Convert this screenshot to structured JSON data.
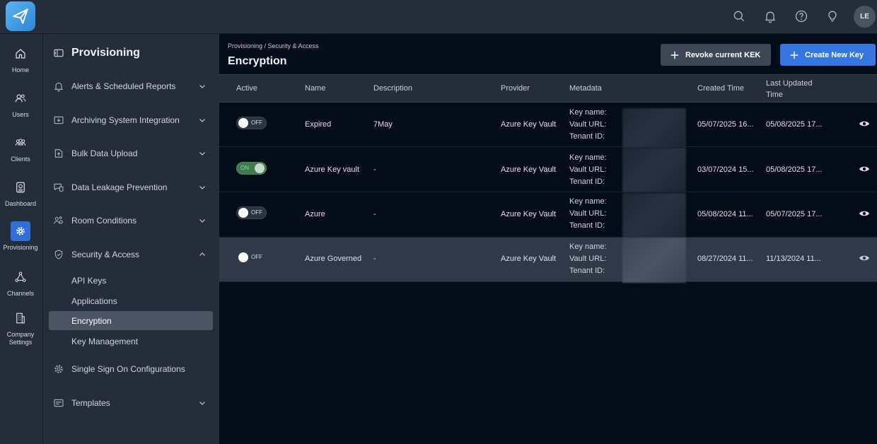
{
  "topbar": {
    "avatar_initials": "LE",
    "icons": [
      "search-icon",
      "bell-icon",
      "help-icon",
      "lightbulb-icon"
    ]
  },
  "rail": {
    "items": [
      {
        "label": "Home",
        "icon": "home-icon"
      },
      {
        "label": "Users",
        "icon": "users-icon"
      },
      {
        "label": "Clients",
        "icon": "clients-icon"
      },
      {
        "label": "Dashboard",
        "icon": "dashboard-icon"
      },
      {
        "label": "Provisioning",
        "icon": "gear-icon",
        "active": true
      },
      {
        "label": "Channels",
        "icon": "channels-icon"
      },
      {
        "label": "Company Settings",
        "icon": "building-icon"
      }
    ]
  },
  "panel": {
    "title": "Provisioning",
    "menu": [
      {
        "label": "Alerts & Scheduled Reports"
      },
      {
        "label": "Archiving System Integration"
      },
      {
        "label": "Bulk Data Upload"
      },
      {
        "label": "Data Leakage Prevention"
      },
      {
        "label": "Room Conditions"
      },
      {
        "label": "Security & Access",
        "expanded": true
      },
      {
        "label": "Single Sign On Configurations"
      },
      {
        "label": "Templates"
      }
    ],
    "submenu": [
      {
        "label": "API Keys"
      },
      {
        "label": "Applications"
      },
      {
        "label": "Encryption",
        "active": true
      },
      {
        "label": "Key Management"
      }
    ]
  },
  "main": {
    "breadcrumb": "Provisioning / Security & Access",
    "title": "Encryption",
    "revoke_label": "Revoke current KEK",
    "create_label": "Create New Key",
    "colors": {
      "accent": "#3577e0",
      "toggle_on": "#3c7b4f"
    },
    "columns": {
      "active": "Active",
      "name": "Name",
      "description": "Description",
      "provider": "Provider",
      "metadata": "Metadata",
      "created": "Created Time",
      "updated": "Last Updated Time"
    },
    "meta_labels": {
      "key_name": "Key name:",
      "vault_url": "Vault URL:",
      "tenant_id": "Tenant ID:"
    },
    "rows": [
      {
        "toggle": "OFF",
        "name": "Expired",
        "description": "7May",
        "provider": "Azure Key Vault",
        "created": "05/07/2025 16...",
        "updated": "05/08/2025 17..."
      },
      {
        "toggle": "ON",
        "name": "Azure Key vault",
        "description": "-",
        "provider": "Azure Key Vault",
        "created": "03/07/2024 15...",
        "updated": "05/08/2025 17..."
      },
      {
        "toggle": "OFF",
        "name": "Azure",
        "description": "-",
        "provider": "Azure Key Vault",
        "created": "05/08/2024 11...",
        "updated": "05/07/2025 17..."
      },
      {
        "toggle": "OFF",
        "name": "Azure Governed",
        "description": "-",
        "provider": "Azure Key Vault",
        "created": "08/27/2024 11...",
        "updated": "11/13/2024 11..."
      }
    ]
  }
}
